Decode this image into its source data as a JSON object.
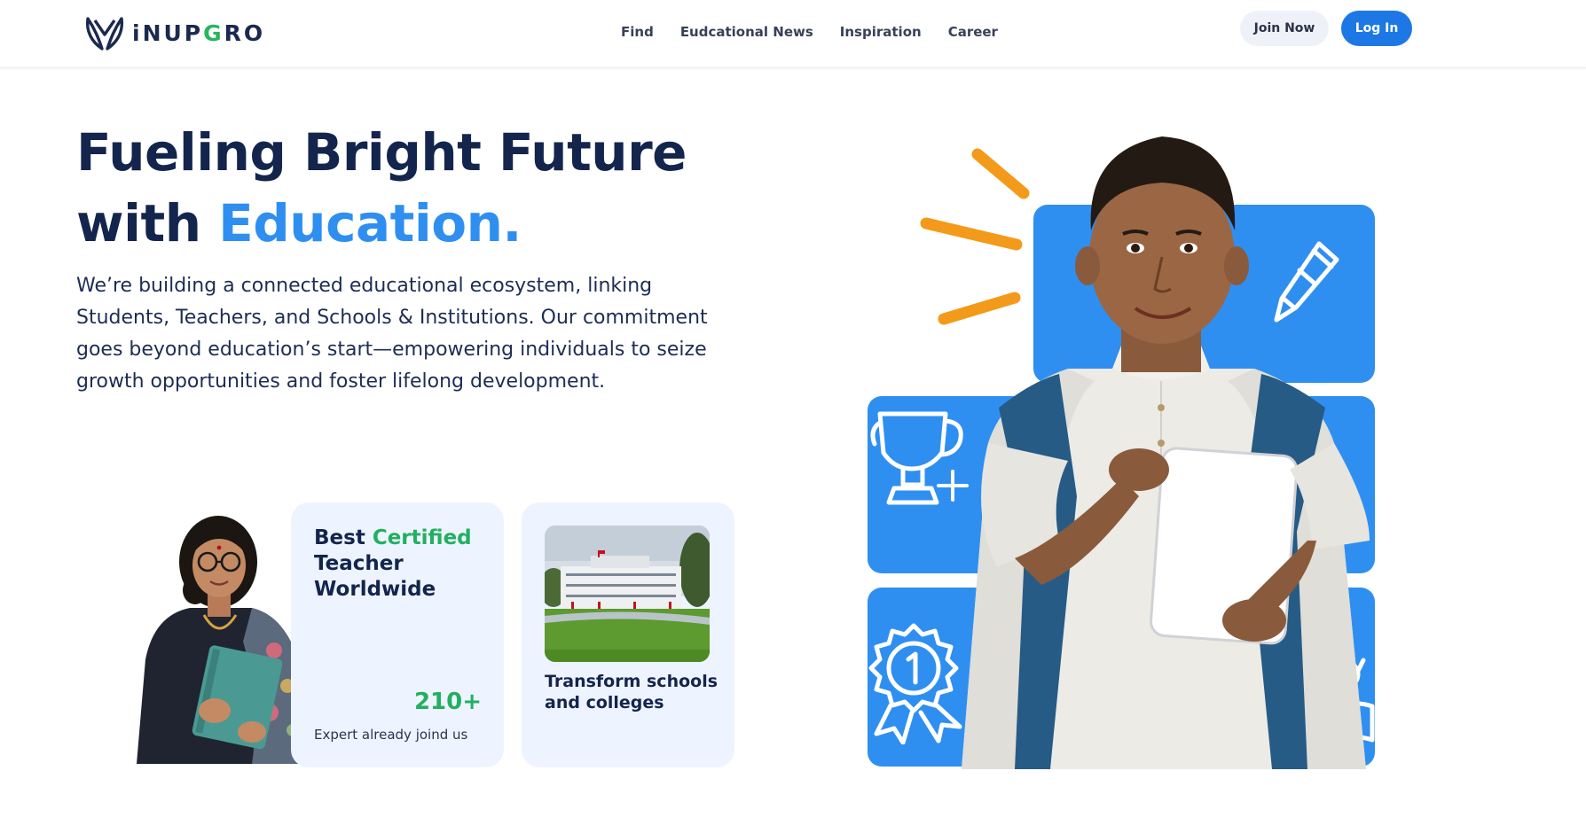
{
  "brand": {
    "name_a": "iNUP",
    "name_b": "G",
    "name_c": "RO"
  },
  "nav": {
    "items": [
      "Find",
      "Eudcational News",
      "Inspiration",
      "Career"
    ],
    "join_label": "Join Now",
    "login_label": "Log In"
  },
  "hero": {
    "title_line1": "Fueling Bright Future",
    "title_line2_prefix": "with ",
    "title_line2_accent": "Education.",
    "description": "We’re building a connected educational ecosystem, linking Students, Teachers, and Schools & Institutions. Our commitment goes beyond education’s start—empowering individuals to seize growth opportunities and foster lifelong development."
  },
  "teacher_card": {
    "title_prefix": "Best ",
    "title_accent": "Certified",
    "title_suffix": " Teacher Worldwide",
    "stat": "210+",
    "caption": "Expert already joind us"
  },
  "school_card": {
    "title": "Transform schools and colleges"
  },
  "colors": {
    "primary": "#1d78e6",
    "accent_blue": "#2f8ff0",
    "accent_green": "#22b060",
    "navy": "#14254d",
    "card_bg": "#eef4ff",
    "orange": "#f39a1a"
  },
  "icons": [
    "logo-mark-icon",
    "pencil-icon",
    "trophy-icon",
    "sparkle-icon",
    "award-medal-icon",
    "glasses-book-icon"
  ]
}
